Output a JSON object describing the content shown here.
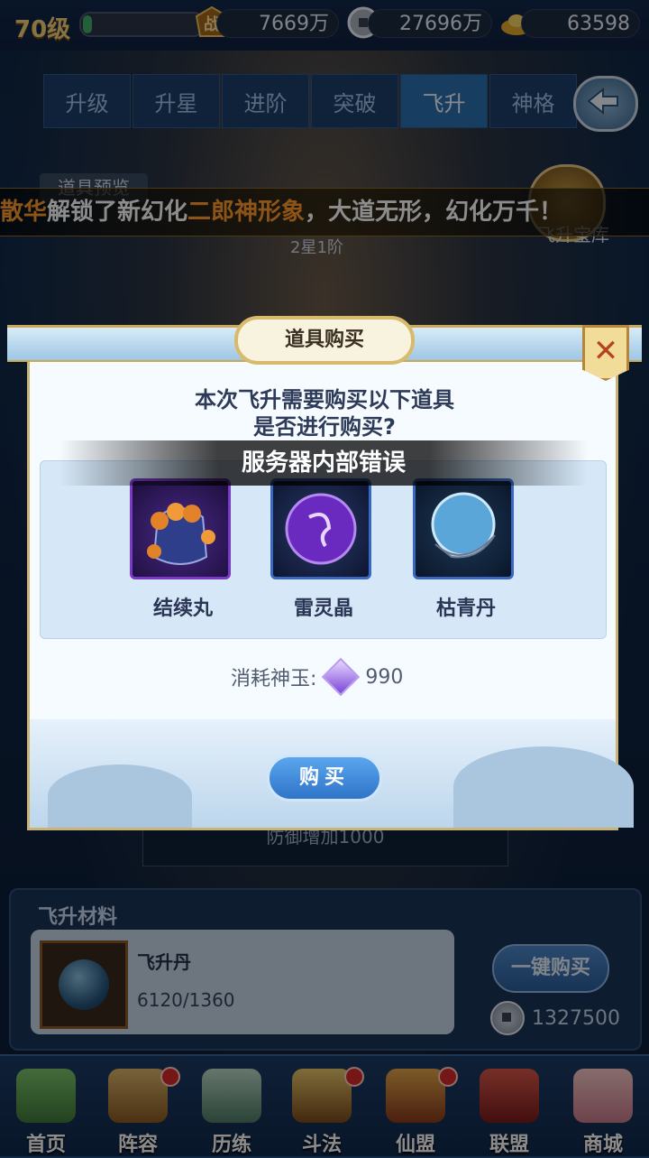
{
  "header": {
    "level": "70级",
    "exp_fraction": 0.08,
    "power_icon_text": "战",
    "power": "7669万",
    "silver": "27696万",
    "gold": "63598"
  },
  "tabs": [
    {
      "label": "升级"
    },
    {
      "label": "升星"
    },
    {
      "label": "进阶"
    },
    {
      "label": "突破"
    },
    {
      "label": "飞升",
      "active": true
    },
    {
      "label": "神格"
    }
  ],
  "background": {
    "preview_tag": "道具预览",
    "marquee": {
      "p1": "散华",
      "p2": "解锁了新幻化",
      "p3": "二郎神形象",
      "p4": "，大道无形，幻化万千！"
    },
    "treasure_label": "飞升宝库",
    "stage_label": "2星1阶",
    "stat_text": "防御增加1000"
  },
  "dialog": {
    "title": "道具购买",
    "close_label": "✕",
    "prompt_line1": "本次飞升需要购买以下道具",
    "prompt_line2": "是否进行购买?",
    "error": "服务器内部错误",
    "items": [
      {
        "name": "结续丸"
      },
      {
        "name": "雷灵晶"
      },
      {
        "name": "枯青丹"
      }
    ],
    "cost_label": "消耗神玉:",
    "cost_value": "990",
    "buy_label": "购买"
  },
  "materials": {
    "title": "飞升材料",
    "item_name": "飞升丹",
    "item_count": "6120/1360",
    "buy_all_label": "一键购买",
    "coins": "1327500"
  },
  "nav": [
    {
      "label": "首页",
      "dot": false
    },
    {
      "label": "阵容",
      "dot": true
    },
    {
      "label": "历练",
      "dot": false
    },
    {
      "label": "斗法",
      "dot": true
    },
    {
      "label": "仙盟",
      "dot": true
    },
    {
      "label": "联盟",
      "dot": false
    },
    {
      "label": "商城",
      "dot": false
    }
  ],
  "colors": {
    "accent_orange": "#ff9a2a",
    "active_tab": "#2b6fb0",
    "notification_dot": "#d82a2a"
  }
}
